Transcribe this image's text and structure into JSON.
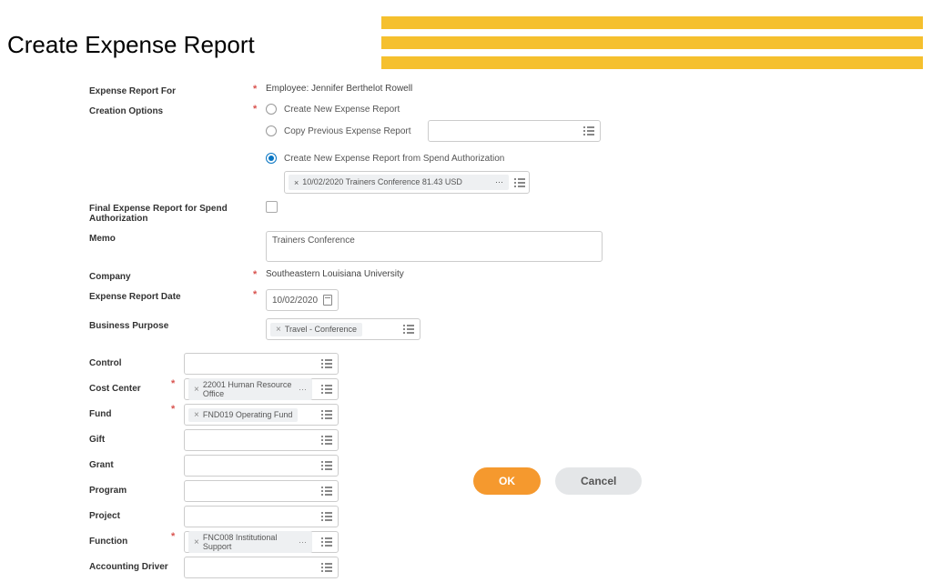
{
  "title": "Create Expense Report",
  "upper": {
    "expenseReportFor": {
      "label": "Expense Report For",
      "value": "Employee: Jennifer Berthelot Rowell"
    },
    "creationOptions": {
      "label": "Creation Options",
      "opt1": "Create New Expense Report",
      "opt2": "Copy Previous Expense Report",
      "opt3": "Create New Expense Report from Spend Authorization",
      "authTag": "10/02/2020 Trainers Conference 81.43 USD"
    },
    "final": {
      "label": "Final Expense Report for Spend Authorization"
    },
    "memo": {
      "label": "Memo",
      "value": "Trainers Conference"
    },
    "company": {
      "label": "Company",
      "value": "Southeastern Louisiana University"
    },
    "date": {
      "label": "Expense Report Date",
      "value": "10/02/2020"
    },
    "purpose": {
      "label": "Business Purpose",
      "tag": "Travel - Conference"
    }
  },
  "lower": {
    "control": {
      "label": "Control"
    },
    "costCenter": {
      "label": "Cost Center",
      "tag": "22001 Human Resource Office"
    },
    "fund": {
      "label": "Fund",
      "tag": "FND019 Operating Fund"
    },
    "gift": {
      "label": "Gift"
    },
    "grant": {
      "label": "Grant"
    },
    "program": {
      "label": "Program"
    },
    "project": {
      "label": "Project"
    },
    "function": {
      "label": "Function",
      "tag": "FNC008 Institutional Support"
    },
    "accountingDriver": {
      "label": "Accounting Driver"
    }
  },
  "buttons": {
    "ok": "OK",
    "cancel": "Cancel"
  }
}
